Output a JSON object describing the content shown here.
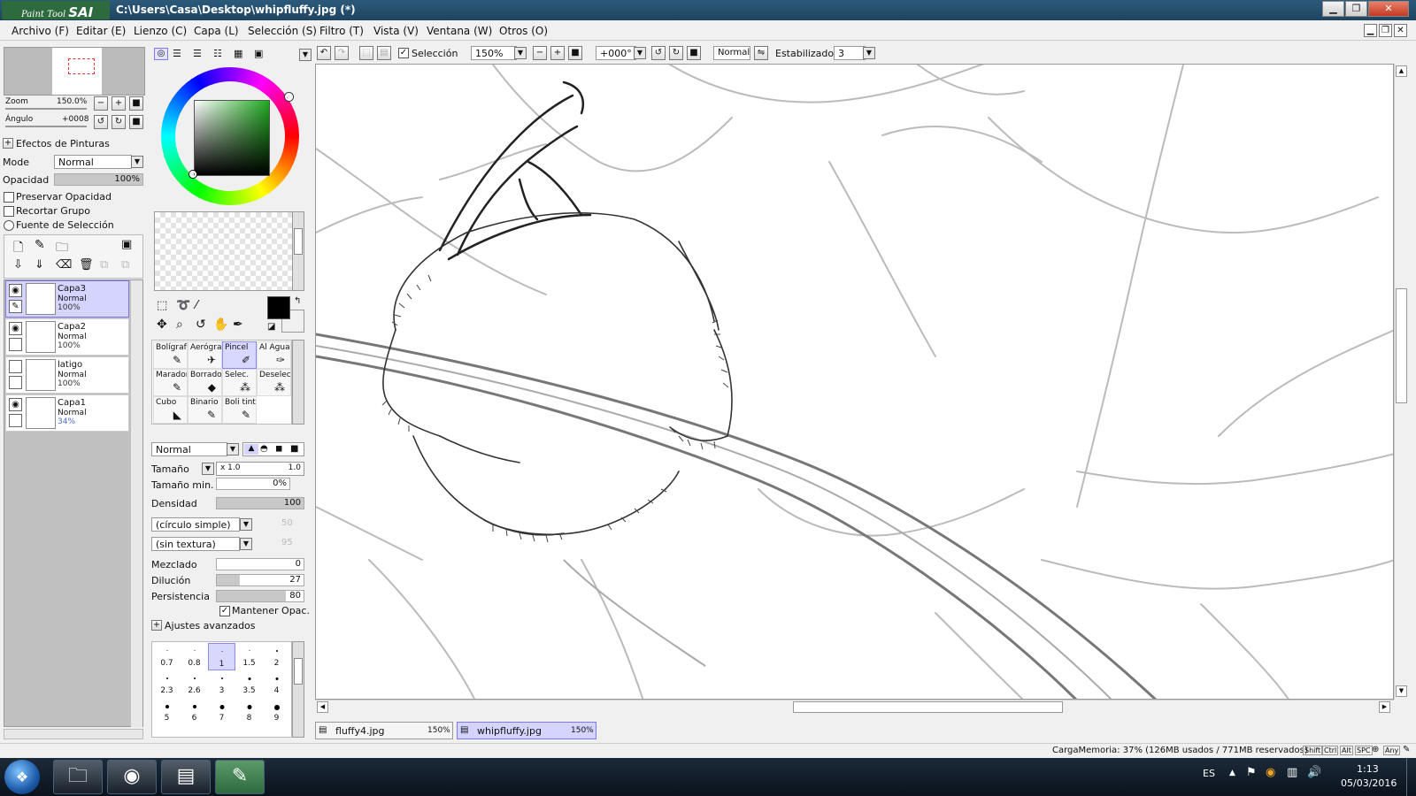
{
  "window": {
    "app_logo_small": "Paint Tool",
    "app_logo_big": "SAI",
    "title": "C:\\Users\\Casa\\Desktop\\whipfluffy.jpg (*)"
  },
  "menu": [
    "Archivo (F)",
    "Editar (E)",
    "Lienzo (C)",
    "Capa (L)",
    "Selección (S)",
    "Filtro (T)",
    "Vista (V)",
    "Ventana (W)",
    "Otros (O)"
  ],
  "navigator": {
    "zoom_label": "Zoom",
    "zoom_value": "150.0%",
    "angle_label": "Ángulo",
    "angle_value": "+0008"
  },
  "paint_effects": {
    "header": "Efectos de Pinturas",
    "mode_label": "Mode",
    "mode_value": "Normal",
    "opacity_label": "Opacidad",
    "opacity_value": "100%",
    "preserve_opacity": "Preservar Opacidad",
    "clip_group": "Recortar Grupo",
    "selection_source": "Fuente de Selección"
  },
  "layers": [
    {
      "name": "Capa3",
      "mode": "Normal",
      "opacity": "100%",
      "visible": true,
      "selected": true
    },
    {
      "name": "Capa2",
      "mode": "Normal",
      "opacity": "100%",
      "visible": true,
      "selected": false
    },
    {
      "name": "latigo",
      "mode": "Normal",
      "opacity": "100%",
      "visible": false,
      "selected": false
    },
    {
      "name": "Capa1",
      "mode": "Normal",
      "opacity": "34%",
      "visible": true,
      "selected": false
    }
  ],
  "tools": [
    {
      "label": "Bolígrafo",
      "icon": "pen-icon",
      "glyph": "✎"
    },
    {
      "label": "Aerógrafo",
      "icon": "airbrush-icon",
      "glyph": "✈"
    },
    {
      "label": "Pincel",
      "icon": "brush-icon",
      "glyph": "✐",
      "selected": true
    },
    {
      "label": "Al Agua",
      "icon": "water-icon",
      "glyph": "✑"
    },
    {
      "label": "Marador",
      "icon": "marker-icon",
      "glyph": "✎"
    },
    {
      "label": "Borrador",
      "icon": "eraser-icon",
      "glyph": "◆"
    },
    {
      "label": "Selec.",
      "icon": "select-pen-icon",
      "glyph": "⁂"
    },
    {
      "label": "Deselec.",
      "icon": "deselect-pen-icon",
      "glyph": "⁂"
    },
    {
      "label": "Cubo",
      "icon": "bucket-icon",
      "glyph": "◣"
    },
    {
      "label": "Binario",
      "icon": "binary-pen-icon",
      "glyph": "✎"
    },
    {
      "label": "Boli tinta",
      "icon": "ink-pen-icon",
      "glyph": "✎"
    }
  ],
  "brush": {
    "blend_mode": "Normal",
    "size_label": "Tamaño",
    "size_mult": "x 1.0",
    "size_value": "1.0",
    "min_size_label": "Tamaño min.",
    "min_size_value": "0%",
    "density_label": "Densidad",
    "density_value": "100",
    "density": 1.0,
    "shape": "(círculo simple)",
    "shape_value": "50",
    "texture": "(sin textura)",
    "texture_value": "95",
    "blend_label": "Mezclado",
    "blend_value": "0",
    "blend": 0.0,
    "dilution_label": "Dilución",
    "dilution_value": "27",
    "dilution": 0.27,
    "persistence_label": "Persistencia",
    "persistence_value": "80",
    "persistence": 0.8,
    "keep_opacity": "Mantener Opac.",
    "advanced": "Ajustes avanzados"
  },
  "brush_sizes": [
    {
      "label": "0.7",
      "d": 1
    },
    {
      "label": "0.8",
      "d": 1
    },
    {
      "label": "1",
      "d": 1,
      "selected": true
    },
    {
      "label": "1.5",
      "d": 1
    },
    {
      "label": "2",
      "d": 2
    },
    {
      "label": "2.3",
      "d": 2
    },
    {
      "label": "2.6",
      "d": 2
    },
    {
      "label": "3",
      "d": 2
    },
    {
      "label": "3.5",
      "d": 3
    },
    {
      "label": "4",
      "d": 3
    },
    {
      "label": "5",
      "d": 4
    },
    {
      "label": "6",
      "d": 4
    },
    {
      "label": "7",
      "d": 5
    },
    {
      "label": "8",
      "d": 5
    },
    {
      "label": "9",
      "d": 6
    }
  ],
  "toolbar": {
    "selection_label": "Selección",
    "zoom": "150%",
    "angle": "+000°",
    "blend": "Normal",
    "stabilizer_label": "Estabilizador",
    "stabilizer_value": "3"
  },
  "tabs": [
    {
      "name": "fluffy4.jpg",
      "zoom": "150%",
      "active": false
    },
    {
      "name": "whipfluffy.jpg",
      "zoom": "150%",
      "active": true
    }
  ],
  "status": {
    "memory": "CargaMemoria: 37% (126MB usados / 771MB reservados)",
    "keys": [
      "Shift",
      "Ctrl",
      "Alt",
      "SPC",
      "Any"
    ]
  },
  "taskbar": {
    "lang": "ES",
    "time": "1:13",
    "date": "05/03/2016"
  },
  "colors": {
    "primary": "#000000",
    "secondary": "#ffffff",
    "wheel_square": "#1faa1f",
    "selection": "#d4d4ff"
  }
}
